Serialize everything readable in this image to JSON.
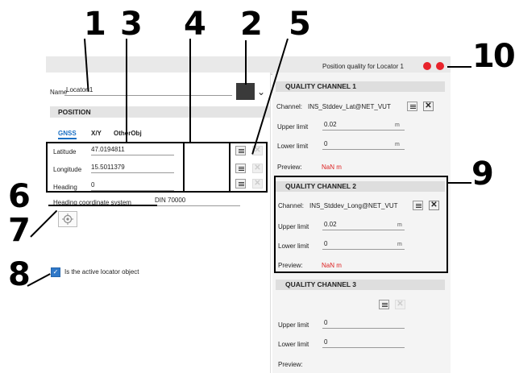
{
  "callouts": [
    "1",
    "3",
    "4",
    "2",
    "5",
    "6",
    "7",
    "8",
    "9",
    "10"
  ],
  "header": {
    "title": "Position quality for Locator 1"
  },
  "status_colors": {
    "dot": "#e8232b",
    "accent": "#1a6fc4",
    "nan": "#d22222"
  },
  "left": {
    "name_label": "Name",
    "name_value": "Locator 1",
    "position_section": "POSITION",
    "tabs": [
      "GNSS",
      "X/Y",
      "OtherObj"
    ],
    "latitude_label": "Latitude",
    "latitude_value": "47.0194811",
    "longitude_label": "Longitude",
    "longitude_value": "15.5011379",
    "heading_label": "Heading",
    "heading_value": "0",
    "hcs_label": "Heading coordinate system",
    "hcs_value": "DIN 70000",
    "active_label": "Is the active locator object"
  },
  "quality": {
    "ch1": {
      "title": "QUALITY CHANNEL 1",
      "channel_label": "Channel:",
      "channel_value": "INS_Stddev_Lat@NET_VUT",
      "upper_label": "Upper limit",
      "upper_value": "0.02",
      "lower_label": "Lower limit",
      "lower_value": "0",
      "unit": "m",
      "preview_label": "Preview:",
      "preview_value": "NaN m"
    },
    "ch2": {
      "title": "QUALITY CHANNEL 2",
      "channel_label": "Channel:",
      "channel_value": "INS_Stddev_Long@NET_VUT",
      "upper_label": "Upper limit",
      "upper_value": "0.02",
      "lower_label": "Lower limit",
      "lower_value": "0",
      "unit": "m",
      "preview_label": "Preview:",
      "preview_value": "NaN m"
    },
    "ch3": {
      "title": "QUALITY CHANNEL 3",
      "upper_label": "Upper limit",
      "upper_value": "0",
      "lower_label": "Lower limit",
      "lower_value": "0",
      "preview_label": "Preview:"
    }
  }
}
